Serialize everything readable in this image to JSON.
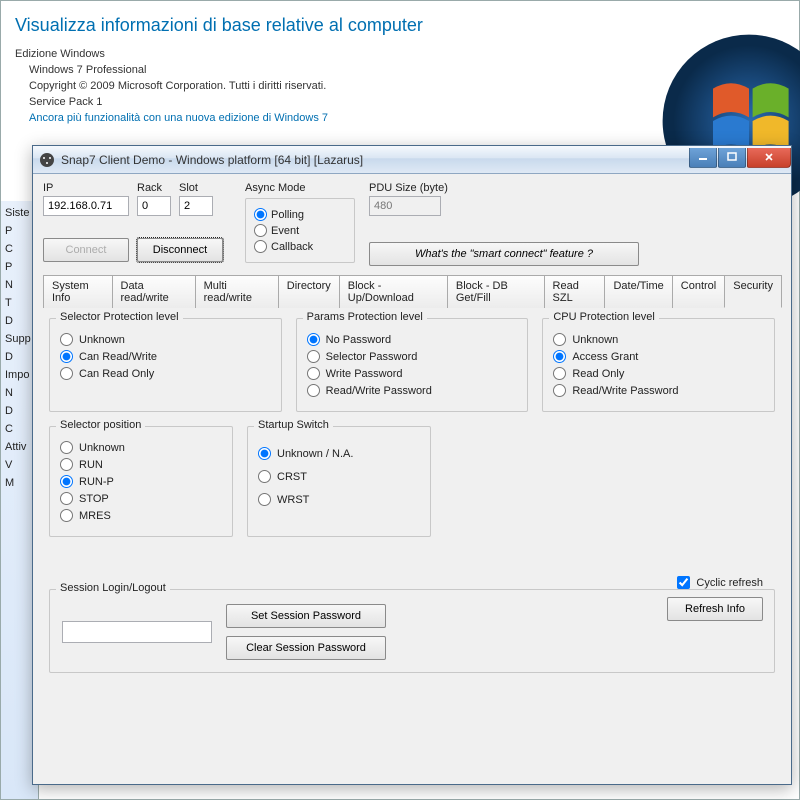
{
  "bg": {
    "heading": "Visualizza informazioni di base relative al computer",
    "edition_label": "Edizione Windows",
    "edition": "Windows 7 Professional",
    "copyright": "Copyright © 2009 Microsoft Corporation. Tutti i diritti riservati.",
    "service_pack": "Service Pack 1",
    "more_link": "Ancora più funzionalità con una nuova edizione di Windows 7",
    "side_items": [
      "Siste",
      "P",
      "C",
      "P",
      "N",
      "T",
      "D",
      "Supp",
      "D",
      "Impo",
      "N",
      "D",
      "C",
      "Attiv",
      "V",
      "M"
    ]
  },
  "window": {
    "title": "Snap7 Client Demo - Windows platform [64 bit] [Lazarus]",
    "ip_label": "IP",
    "ip": "192.168.0.71",
    "rack_label": "Rack",
    "rack": "0",
    "slot_label": "Slot",
    "slot": "2",
    "connect": "Connect",
    "disconnect": "Disconnect",
    "async_label": "Async Mode",
    "async": {
      "polling": "Polling",
      "event": "Event",
      "callback": "Callback"
    },
    "pdu_label": "PDU Size (byte)",
    "pdu": "480",
    "smart_btn": "What's the \"smart connect\" feature ?",
    "tabs": [
      "System Info",
      "Data read/write",
      "Multi read/write",
      "Directory",
      "Block - Up/Download",
      "Block - DB Get/Fill",
      "Read SZL",
      "Date/Time",
      "Control",
      "Security"
    ],
    "active_tab": 9,
    "security": {
      "selector_prot": {
        "legend": "Selector Protection level",
        "opts": [
          "Unknown",
          "Can Read/Write",
          "Can Read Only"
        ],
        "sel": 1
      },
      "params_prot": {
        "legend": "Params Protection level",
        "opts": [
          "No Password",
          "Selector Password",
          "Write Password",
          "Read/Write Password"
        ],
        "sel": 0
      },
      "cpu_prot": {
        "legend": "CPU Protection level",
        "opts": [
          "Unknown",
          "Access Grant",
          "Read Only",
          "Read/Write Password"
        ],
        "sel": 1
      },
      "selector_pos": {
        "legend": "Selector position",
        "opts": [
          "Unknown",
          "RUN",
          "RUN-P",
          "STOP",
          "MRES"
        ],
        "sel": 2
      },
      "startup": {
        "legend": "Startup Switch",
        "opts": [
          "Unknown / N.A.",
          "CRST",
          "WRST"
        ],
        "sel": 0
      },
      "cyclic": "Cyclic refresh",
      "cyclic_on": true,
      "refresh": "Refresh Info",
      "session_legend": "Session Login/Logout",
      "set_pwd": "Set Session Password",
      "clear_pwd": "Clear Session Password"
    }
  }
}
